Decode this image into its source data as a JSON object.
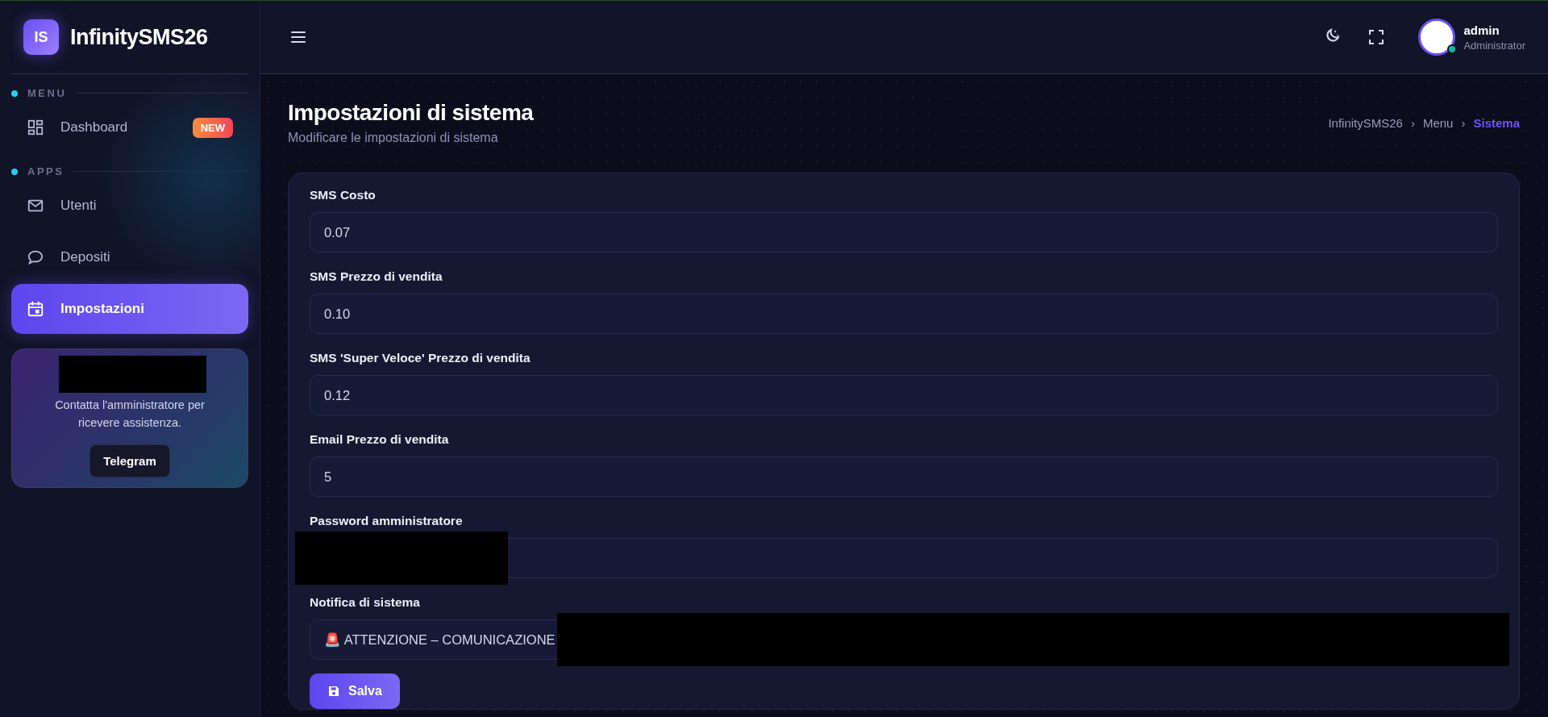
{
  "brand": {
    "logo": "IS",
    "name": "InfinitySMS26"
  },
  "sidebar": {
    "sections": [
      {
        "title": "MENU",
        "items": [
          {
            "label": "Dashboard",
            "badge": "NEW",
            "selected": false
          }
        ]
      },
      {
        "title": "APPS",
        "items": [
          {
            "label": "Utenti",
            "selected": false
          },
          {
            "label": "Depositi",
            "selected": false
          },
          {
            "label": "Impostazioni",
            "selected": true
          }
        ]
      }
    ],
    "help_card": {
      "text": "Contatta l'amministratore per ricevere assistenza.",
      "button": "Telegram"
    }
  },
  "user": {
    "name": "admin",
    "role": "Administrator",
    "online": true
  },
  "page": {
    "title": "Impostazioni di sistema",
    "subtitle": "Modificare le impostazioni di sistema",
    "breadcrumb_separator": "›",
    "breadcrumb": [
      {
        "label": "InfinitySMS26",
        "selected": false
      },
      {
        "label": "Menu",
        "selected": false
      },
      {
        "label": "Sistema",
        "selected": true
      }
    ]
  },
  "form": {
    "fields": [
      {
        "label": "SMS Costo",
        "value": "0.07"
      },
      {
        "label": "SMS Prezzo di vendita",
        "value": "0.10"
      },
      {
        "label": "SMS 'Super Veloce' Prezzo di vendita",
        "value": "0.12"
      },
      {
        "label": "Email Prezzo di vendita",
        "value": "5"
      },
      {
        "label": "Password amministratore",
        "redacted": true
      },
      {
        "label": "Notifica di sistema",
        "value": "🚨 ATTENZIONE – COMUNICAZIONE",
        "redacted": true
      }
    ],
    "submit": "Salva"
  }
}
